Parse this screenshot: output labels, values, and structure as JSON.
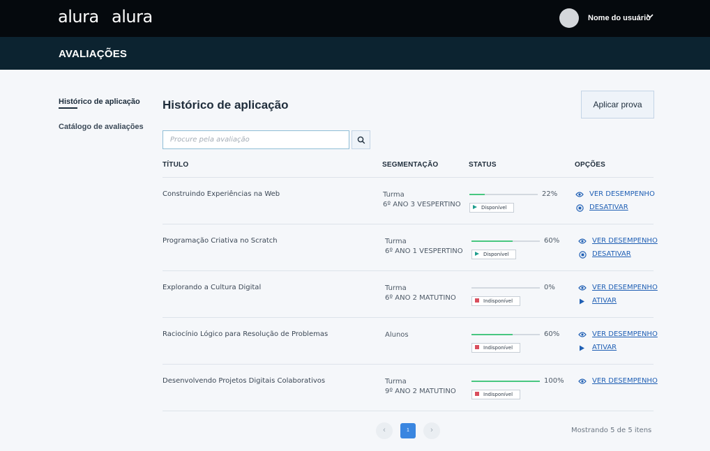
{
  "header": {
    "logos": [
      "alura",
      "alura"
    ],
    "user_name": "Nome do usuário"
  },
  "subheader": {
    "title": "AVALIAÇÕES"
  },
  "sidebar": {
    "items": [
      {
        "label": "Histórico de aplicação",
        "active": true
      },
      {
        "label": "Catálogo de avaliações",
        "active": false
      }
    ]
  },
  "main": {
    "title": "Histórico de aplicação",
    "apply_button": "Aplicar prova",
    "search": {
      "placeholder": "Procure pela avaliação",
      "value": ""
    },
    "columns": [
      "TÍTULO",
      "SEGMENTAÇÃO",
      "STATUS",
      "OPÇÕES"
    ],
    "rows": [
      {
        "title": "Construindo Experiências na Web",
        "segment": "Turma",
        "segment_detail": "6º ANO 3 VESPERTINO",
        "progress_pct": 22,
        "progress_label": "22%",
        "status": "Disponível",
        "status_type": "available",
        "options": [
          {
            "label": "VER DESEMPENHO",
            "icon": "eye-icon"
          },
          {
            "label": "DESATIVAR",
            "icon": "stop-circle-icon"
          }
        ]
      },
      {
        "title": "Programação Criativa no Scratch",
        "segment": "Turma",
        "segment_detail": "6º ANO 1 VESPERTINO",
        "progress_pct": 60,
        "progress_label": "60%",
        "status": "Disponível",
        "status_type": "available",
        "options": [
          {
            "label": "VER DESEMPENHO",
            "icon": "eye-icon"
          },
          {
            "label": "DESATIVAR",
            "icon": "stop-circle-icon"
          }
        ]
      },
      {
        "title": "Explorando a Cultura Digital",
        "segment": "Turma",
        "segment_detail": "6º ANO 2 MATUTINO",
        "progress_pct": 0,
        "progress_label": "0%",
        "status": "Indisponível",
        "status_type": "unavailable",
        "options": [
          {
            "label": "VER DESEMPENHO",
            "icon": "eye-icon"
          },
          {
            "label": "ATIVAR",
            "icon": "play-icon"
          }
        ]
      },
      {
        "title": "Raciocínio Lógico para Resolução de Problemas",
        "segment": "Alunos",
        "segment_detail": "",
        "progress_pct": 60,
        "progress_label": "60%",
        "status": "Indisponível",
        "status_type": "unavailable",
        "options": [
          {
            "label": "VER DESEMPENHO",
            "icon": "eye-icon"
          },
          {
            "label": "ATIVAR",
            "icon": "play-icon"
          }
        ]
      },
      {
        "title": "Desenvolvendo Projetos Digitais Colaborativos",
        "segment": "Turma",
        "segment_detail": "9º ANO 2 MATUTINO",
        "progress_pct": 100,
        "progress_label": "100%",
        "status": "Indisponível",
        "status_type": "unavailable",
        "options": [
          {
            "label": "VER DESEMPENHO",
            "icon": "eye-icon"
          }
        ]
      }
    ],
    "pagination": {
      "current_page": "1",
      "showing_text": "Mostrando 5 de 5 itens"
    }
  },
  "colors": {
    "progress": "#48c780",
    "link": "#1f5fb4",
    "available": "#1f9d8e",
    "unavailable": "#d94e5d",
    "primary_button": "#3a86e0"
  }
}
